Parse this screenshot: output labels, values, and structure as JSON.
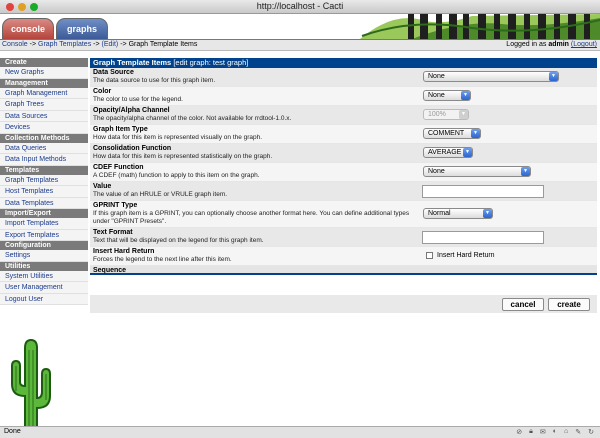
{
  "window": {
    "title": "http://localhost - Cacti"
  },
  "tabs": [
    {
      "label": "console"
    },
    {
      "label": "graphs"
    }
  ],
  "breadcrumb": {
    "items": [
      "Console",
      "Graph Templates",
      "(Edit)"
    ],
    "current": "Graph Template Items"
  },
  "login": {
    "prefix": "Logged in as",
    "user": "admin",
    "logout": "(Logout)"
  },
  "sidebar": {
    "sections": [
      {
        "heading": "Create",
        "items": [
          "New Graphs"
        ]
      },
      {
        "heading": "Management",
        "items": [
          "Graph Management",
          "Graph Trees",
          "Data Sources",
          "Devices"
        ]
      },
      {
        "heading": "Collection Methods",
        "items": [
          "Data Queries",
          "Data Input Methods"
        ]
      },
      {
        "heading": "Templates",
        "items": [
          "Graph Templates",
          "Host Templates",
          "Data Templates"
        ]
      },
      {
        "heading": "Import/Export",
        "items": [
          "Import Templates",
          "Export Templates"
        ]
      },
      {
        "heading": "Configuration",
        "items": [
          "Settings"
        ]
      },
      {
        "heading": "Utilities",
        "items": [
          "System Utilities",
          "User Management",
          "Logout User"
        ]
      }
    ]
  },
  "form": {
    "header": "Graph Template Items",
    "header_sub": "[edit graph: test graph]",
    "fields": [
      {
        "label": "Data Source",
        "desc": "The data source to use for this graph item.",
        "value": "None"
      },
      {
        "label": "Color",
        "desc": "The color to use for the legend.",
        "value": "None"
      },
      {
        "label": "Opacity/Alpha Channel",
        "desc": "The opacity/alpha channel of the color. Not available for rrdtool-1.0.x.",
        "value": "100%"
      },
      {
        "label": "Graph Item Type",
        "desc": "How data for this item is represented visually on the graph.",
        "value": "COMMENT"
      },
      {
        "label": "Consolidation Function",
        "desc": "How data for this item is represented statistically on the graph.",
        "value": "AVERAGE"
      },
      {
        "label": "CDEF Function",
        "desc": "A CDEF (math) function to apply to this item on the graph.",
        "value": "None"
      },
      {
        "label": "Value",
        "desc": "The value of an HRULE or VRULE graph item.",
        "value": ""
      },
      {
        "label": "GPRINT Type",
        "desc": "If this graph item is a GPRINT, you can optionally choose another format here. You can define additional types under \"GPRINT Presets\".",
        "value": "Normal"
      },
      {
        "label": "Text Format",
        "desc": "Text that will be displayed on the legend for this graph item.",
        "value": ""
      },
      {
        "label": "Insert Hard Return",
        "desc": "Forces the legend to the next line after this item.",
        "checkbox_label": "Insert Hard Return",
        "checked": false
      }
    ],
    "sequence_label": "Sequence"
  },
  "buttons": {
    "cancel": "cancel",
    "create": "create"
  },
  "status": {
    "text": "Done"
  },
  "colors": {
    "header_blue": "#00438c",
    "console_tab": "#b5443c",
    "graphs_tab": "#3c5a98",
    "menu_heading": "#7a7a7a"
  }
}
